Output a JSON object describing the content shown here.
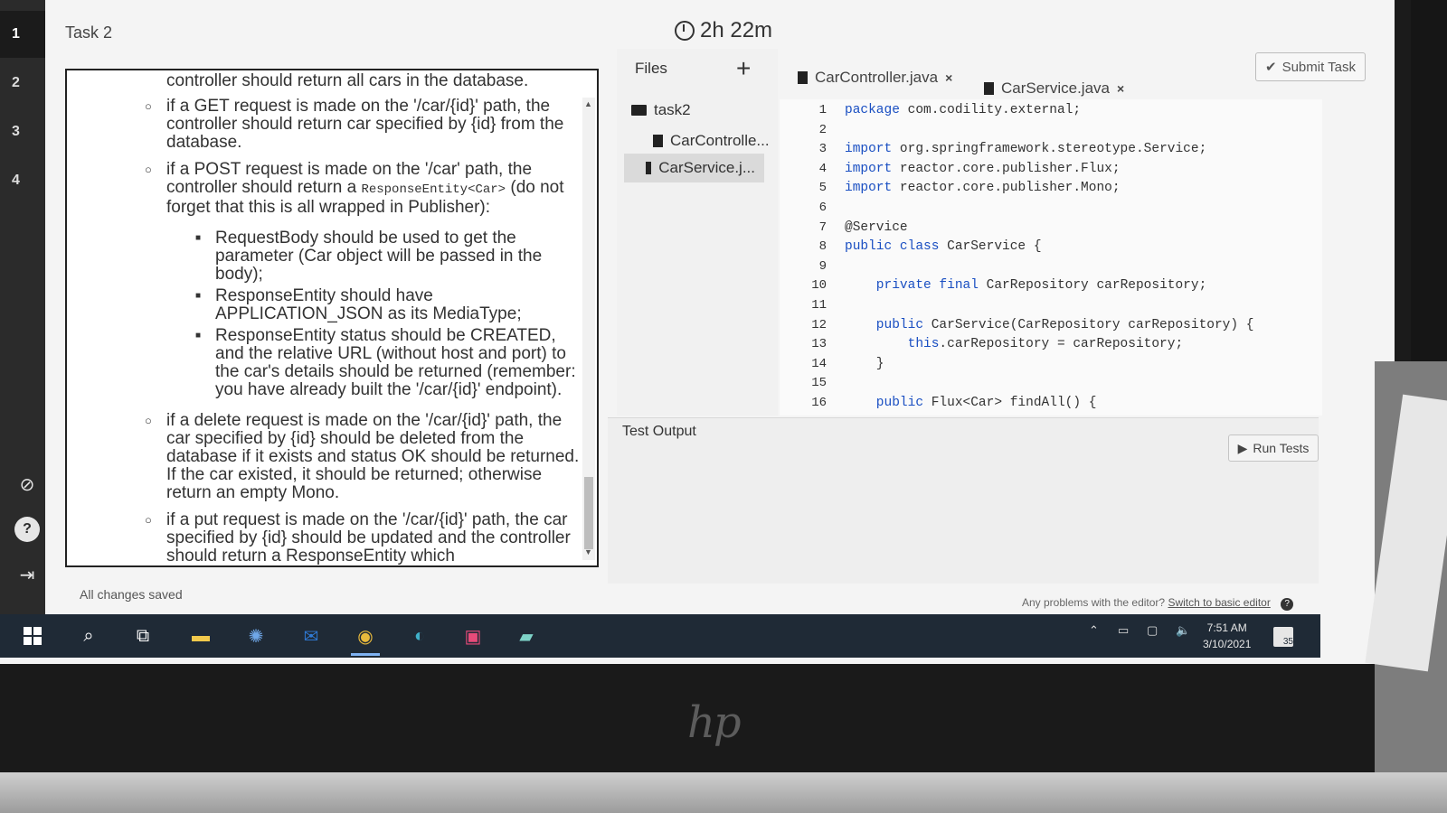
{
  "rail": {
    "items": [
      "1",
      "2",
      "3",
      "4"
    ]
  },
  "header": {
    "task_title": "Task 2",
    "timer": "2h 22m",
    "submit_label": "Submit Task"
  },
  "description": {
    "line0": "controller should return all cars in the database.",
    "bullet_get": "if a GET request is made on the '/car/{id}' path, the controller should return car specified by {id} from the database.",
    "bullet_post_a": "if a POST request is made on the '/car' path, the controller should return a ",
    "bullet_post_code": "ResponseEntity<Car>",
    "bullet_post_b": " (do not forget that this is all wrapped in Publisher):",
    "sub1": "RequestBody should be used to get the parameter (Car object will be passed in the body);",
    "sub2": "ResponseEntity should have APPLICATION_JSON as its MediaType;",
    "sub3": "ResponseEntity status should be CREATED, and the relative URL (without host and port) to the car's details should be returned (remember: you have already built the '/car/{id}' endpoint).",
    "bullet_delete": "if a delete request is made on the '/car/{id}' path, the car specified by {id} should be deleted from the database if it exists and status OK should be returned. If the car existed, it should be returned; otherwise return an empty Mono.",
    "bullet_put": "if a put request is made on the '/car/{id}' path, the car specified by {id} should be updated and the controller should return a ResponseEntity which"
  },
  "files": {
    "title": "Files",
    "add_label": "+",
    "folder": "task2",
    "items": [
      "CarControlle...",
      "CarService.j..."
    ]
  },
  "tabs": [
    {
      "label": "CarController.java",
      "close": "×"
    },
    {
      "label": "CarService.java",
      "close": "×"
    }
  ],
  "editor": {
    "lines": [
      {
        "n": "1",
        "kw": "package",
        "rest": " com.codility.external;"
      },
      {
        "n": "2",
        "kw": "",
        "rest": ""
      },
      {
        "n": "3",
        "kw": "import",
        "rest": " org.springframework.stereotype.Service;"
      },
      {
        "n": "4",
        "kw": "import",
        "rest": " reactor.core.publisher.Flux;"
      },
      {
        "n": "5",
        "kw": "import",
        "rest": " reactor.core.publisher.Mono;"
      },
      {
        "n": "6",
        "kw": "",
        "rest": ""
      },
      {
        "n": "7",
        "kw": "",
        "rest": "@Service"
      },
      {
        "n": "8",
        "kw": "public class",
        "rest": " CarService {"
      },
      {
        "n": "9",
        "kw": "",
        "rest": ""
      },
      {
        "n": "10",
        "kw": "    private final",
        "rest": " CarRepository carRepository;"
      },
      {
        "n": "11",
        "kw": "",
        "rest": ""
      },
      {
        "n": "12",
        "kw": "    public",
        "rest": " CarService(CarRepository carRepository) {"
      },
      {
        "n": "13",
        "kw": "        this",
        "rest": ".carRepository = carRepository;"
      },
      {
        "n": "14",
        "kw": "",
        "rest": "    }"
      },
      {
        "n": "15",
        "kw": "",
        "rest": ""
      },
      {
        "n": "16",
        "kw": "    public",
        "rest": " Flux<Car> findAll() {"
      }
    ]
  },
  "test_output": {
    "title": "Test Output",
    "run_label": "Run Tests"
  },
  "status": {
    "saved": "All changes saved",
    "problems": "Any problems with the editor?",
    "problems_link": "Switch to basic editor"
  },
  "taskbar": {
    "time": "7:51 AM",
    "date": "3/10/2021",
    "notifications": "35"
  }
}
